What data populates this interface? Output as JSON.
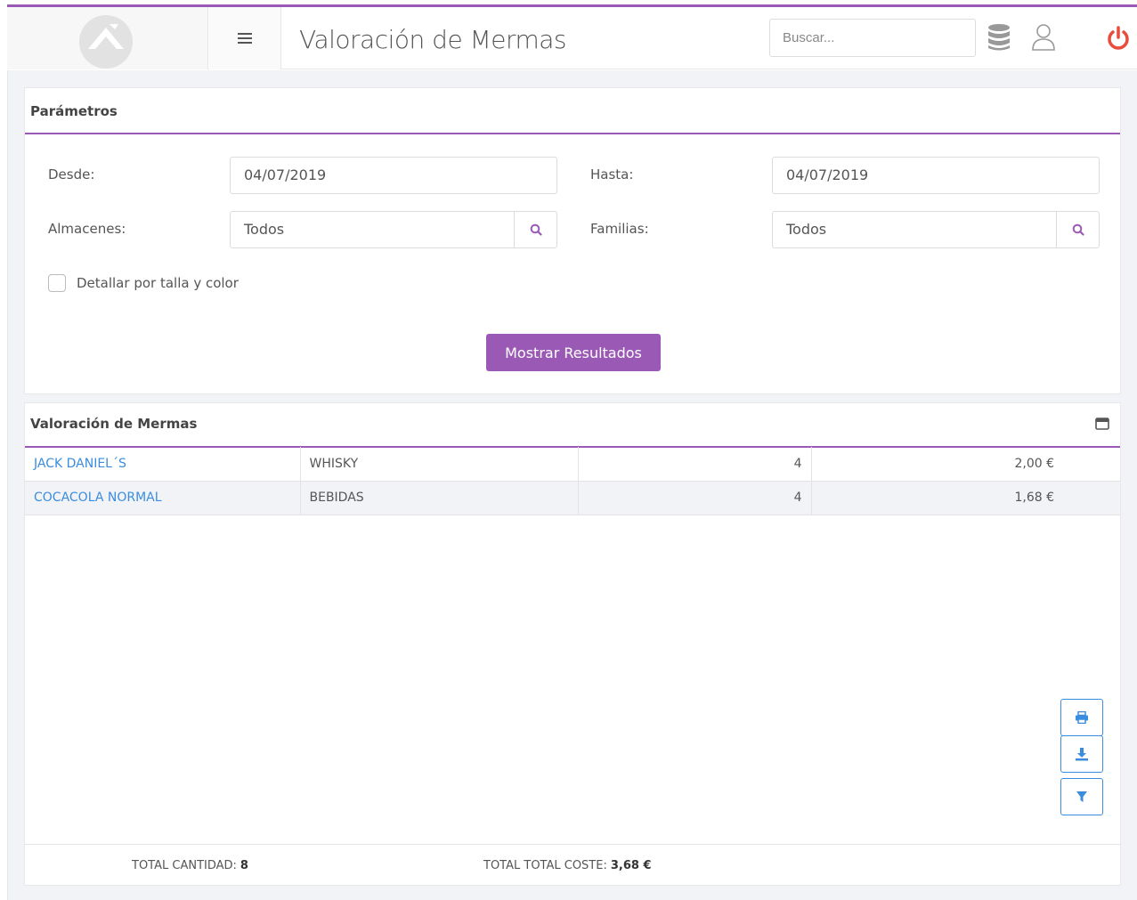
{
  "header": {
    "title": "Valoración de Mermas",
    "search_placeholder": "Buscar...",
    "menu_icon": "hamburger-icon",
    "database_icon": "database-icon",
    "user_icon": "user-icon",
    "power_icon": "power-icon"
  },
  "colors": {
    "accent": "#9b59b6",
    "link": "#3a8dde",
    "power": "#e74c3c"
  },
  "params": {
    "title": "Parámetros",
    "desde_label": "Desde:",
    "desde_value": "04/07/2019",
    "hasta_label": "Hasta:",
    "hasta_value": "04/07/2019",
    "almacenes_label": "Almacenes:",
    "almacenes_value": "Todos",
    "familias_label": "Familias:",
    "familias_value": "Todos",
    "detallar_label": "Detallar por talla y color",
    "detallar_checked": false,
    "submit_label": "Mostrar Resultados"
  },
  "results": {
    "title": "Valoración de Mermas",
    "rows": [
      {
        "name": "JACK DANIEL´S",
        "family": "WHISKY",
        "quantity": "4",
        "cost": "2,00 €"
      },
      {
        "name": "COCACOLA NORMAL",
        "family": "BEBIDAS",
        "quantity": "4",
        "cost": "1,68 €"
      }
    ],
    "tools": [
      "print-icon",
      "download-icon",
      "filter-icon"
    ],
    "footer": {
      "total_cantidad_label": "TOTAL CANTIDAD:",
      "total_cantidad_value": "8",
      "total_coste_label": "TOTAL TOTAL COSTE:",
      "total_coste_value": "3,68 €"
    }
  }
}
